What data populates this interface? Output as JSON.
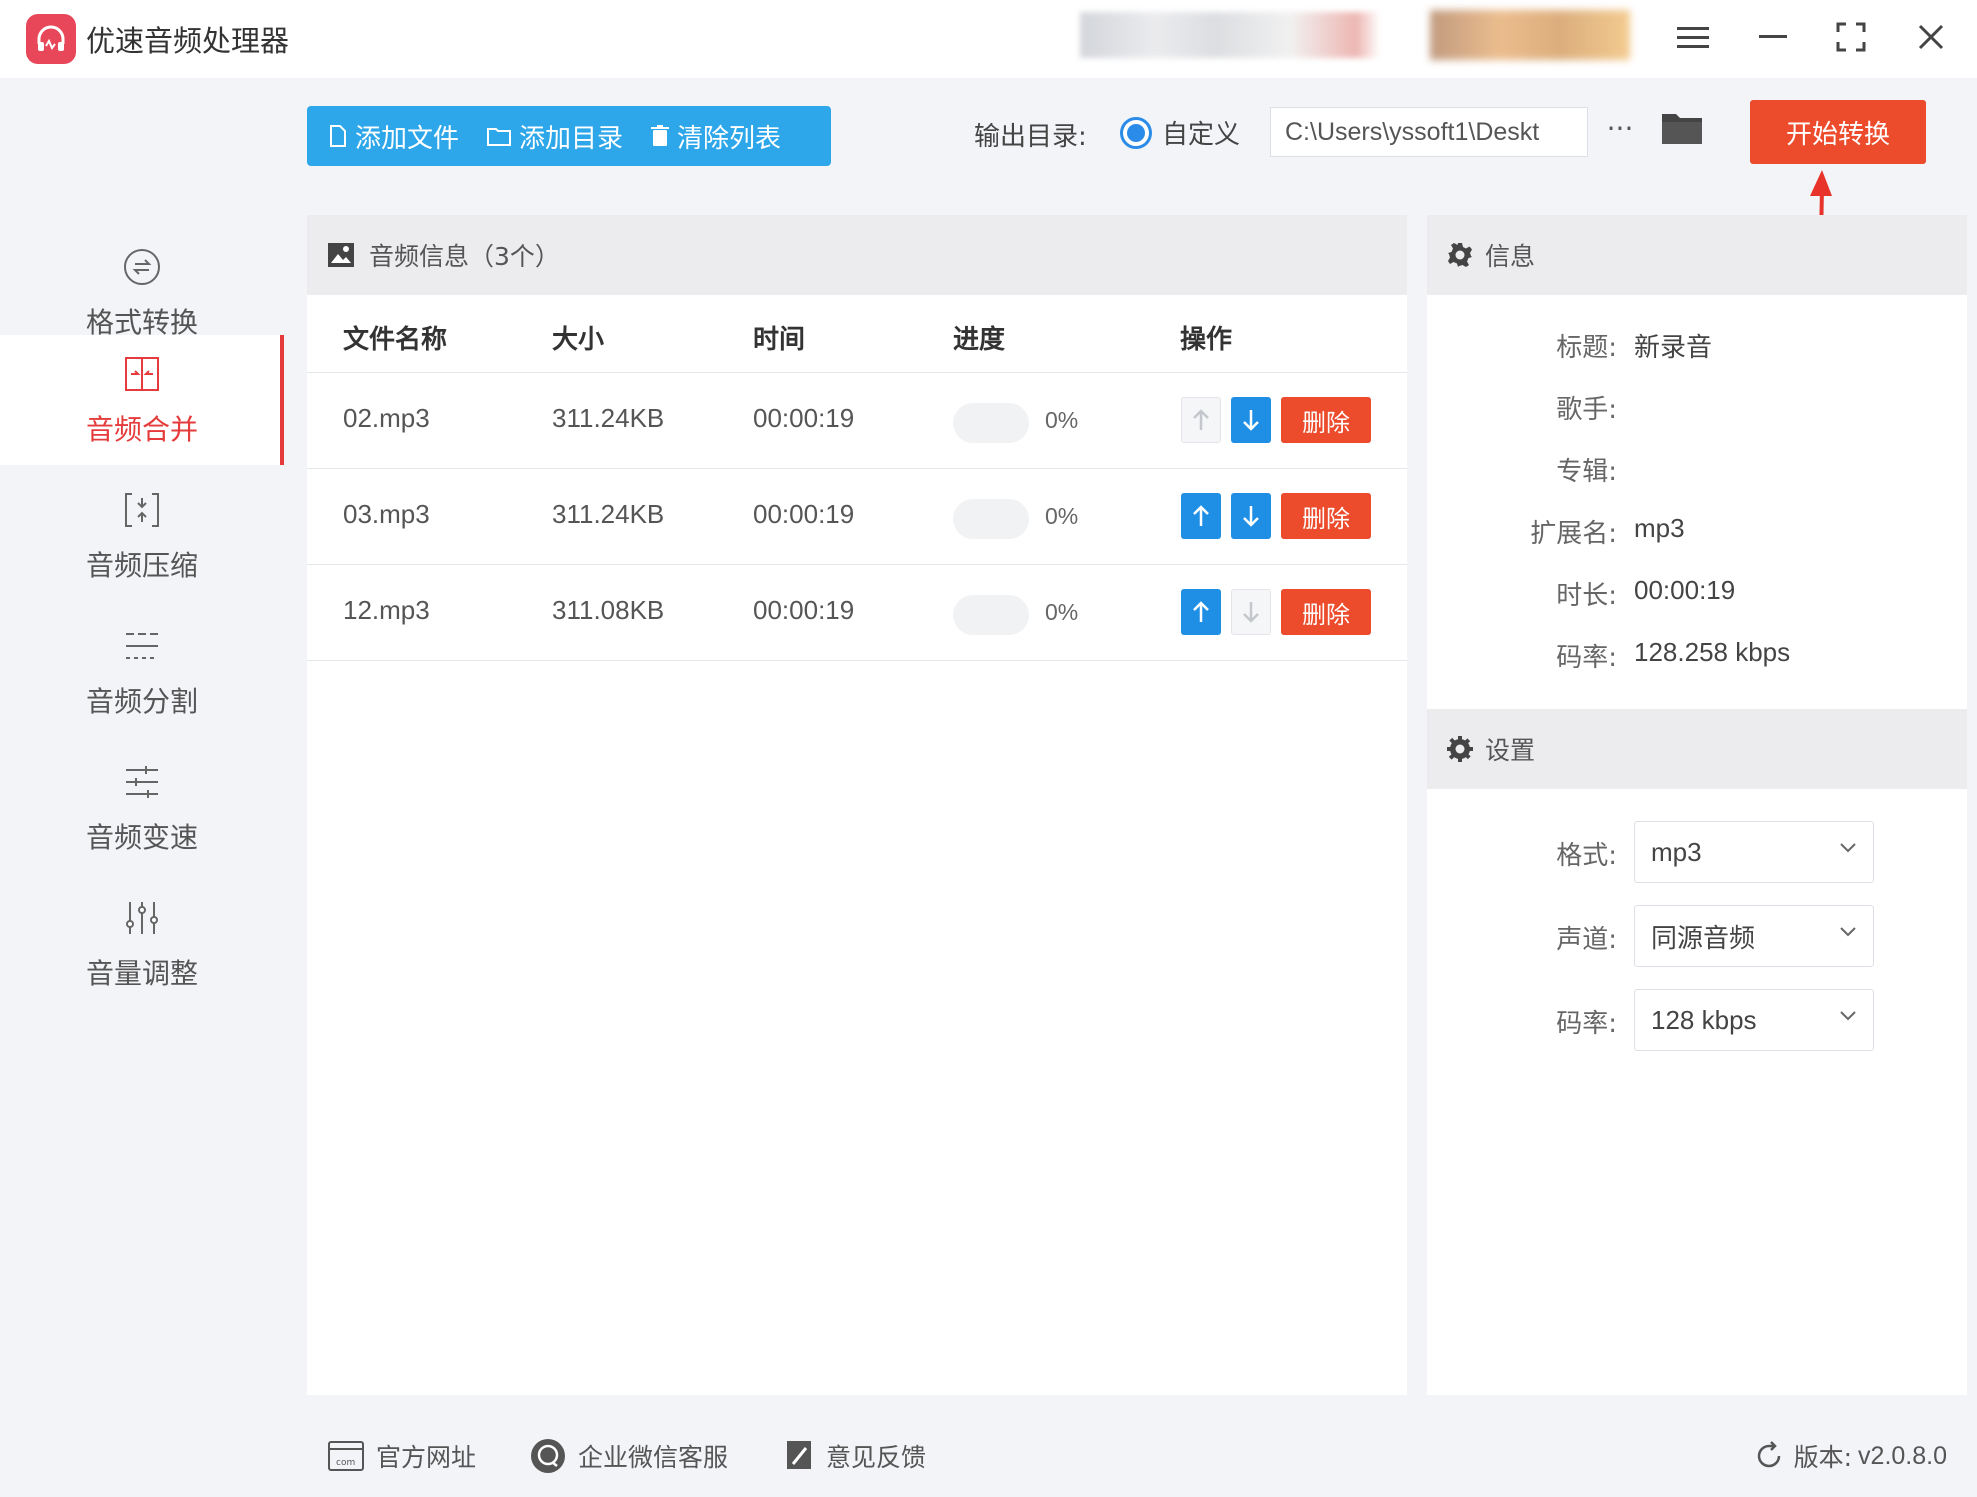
{
  "app": {
    "title": "优速音频处理器",
    "brand_color": "#e8475a",
    "accent_color": "#2ea7ea",
    "danger_color": "#ec4b2c"
  },
  "window_controls": [
    "menu-icon",
    "minimize-icon",
    "fullscreen-icon",
    "close-icon"
  ],
  "sidebar": {
    "items": [
      {
        "label": "格式转换",
        "icon": "convert-icon",
        "active": false
      },
      {
        "label": "音频合并",
        "icon": "merge-icon",
        "active": true
      },
      {
        "label": "音频压缩",
        "icon": "compress-icon",
        "active": false
      },
      {
        "label": "音频分割",
        "icon": "split-icon",
        "active": false
      },
      {
        "label": "音频变速",
        "icon": "speed-icon",
        "active": false
      },
      {
        "label": "音量调整",
        "icon": "volume-icon",
        "active": false
      }
    ]
  },
  "toolbar": {
    "add_file": "添加文件",
    "add_dir": "添加目录",
    "clear_list": "清除列表",
    "output_label": "输出目录:",
    "radio_label": "自定义",
    "output_path": "C:\\Users\\yssoft1\\Deskt",
    "more": "···",
    "start": "开始转换"
  },
  "file_panel": {
    "title": "音频信息（3个）",
    "columns": [
      "文件名称",
      "大小",
      "时间",
      "进度",
      "操作"
    ],
    "rows": [
      {
        "name": "02.mp3",
        "size": "311.24KB",
        "time": "00:00:19",
        "progress": "0%",
        "up_enabled": false,
        "down_enabled": true
      },
      {
        "name": "03.mp3",
        "size": "311.24KB",
        "time": "00:00:19",
        "progress": "0%",
        "up_enabled": true,
        "down_enabled": true
      },
      {
        "name": "12.mp3",
        "size": "311.08KB",
        "time": "00:00:19",
        "progress": "0%",
        "up_enabled": true,
        "down_enabled": false
      }
    ],
    "delete_label": "删除"
  },
  "info_panel": {
    "title": "信息",
    "fields": [
      {
        "key": "标题:",
        "value": "新录音"
      },
      {
        "key": "歌手:",
        "value": ""
      },
      {
        "key": "专辑:",
        "value": ""
      },
      {
        "key": "扩展名:",
        "value": "mp3"
      },
      {
        "key": "时长:",
        "value": "00:00:19"
      },
      {
        "key": "码率:",
        "value": "128.258 kbps"
      }
    ]
  },
  "settings_panel": {
    "title": "设置",
    "fields": [
      {
        "key": "格式:",
        "value": "mp3"
      },
      {
        "key": "声道:",
        "value": "同源音频"
      },
      {
        "key": "码率:",
        "value": "128 kbps"
      }
    ]
  },
  "footer": {
    "website": "官方网址",
    "wechat": "企业微信客服",
    "feedback": "意见反馈",
    "version_label": "版本:",
    "version": "v2.0.8.0"
  }
}
